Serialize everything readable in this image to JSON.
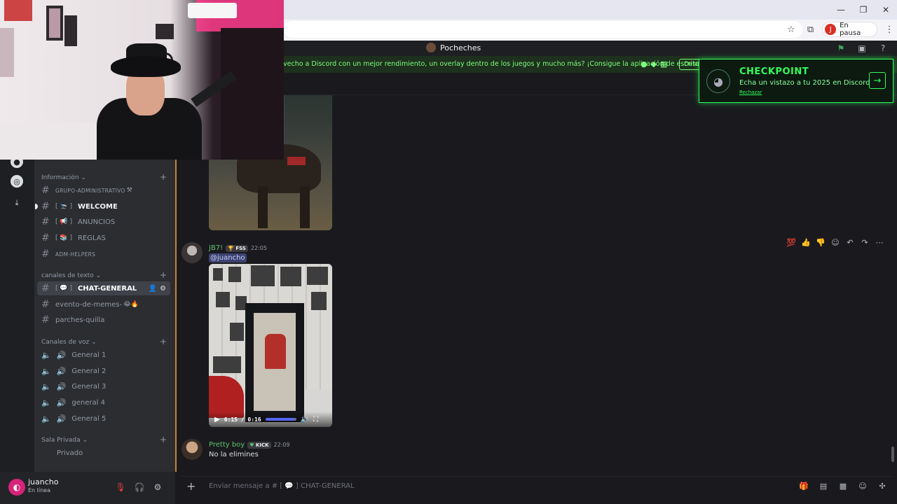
{
  "browser": {
    "profile_initial": "J",
    "profile_status": "En pausa"
  },
  "discord": {
    "server_name": "Pocheches",
    "promo_text": "vecho a Discord con un mejor rendimiento, un overlay dentro de los juegos y mucho más? ¡Consigue la aplicación de escritorio!",
    "promo_button": "Desc"
  },
  "checkpoint": {
    "title": "CHECKPOINT",
    "subtitle": "Echa un vistazo a tu 2025 en Discord",
    "dismiss": "Rechazar"
  },
  "sidebar": {
    "categories": [
      {
        "label": "Información"
      },
      {
        "label": "canales de texto"
      },
      {
        "label": "Canales de voz"
      },
      {
        "label": "Sala Privada"
      }
    ],
    "channels": [
      {
        "label": "GRUPO-ADMINISTRATIVO",
        "emoji": "⚒"
      },
      {
        "label": "WELCOME",
        "prefix": "[ 🛬 ]"
      },
      {
        "label": "ANUNCIOS",
        "prefix": "[ 📢 ]"
      },
      {
        "label": "REGLAS",
        "prefix": "[ 📚 ]"
      },
      {
        "label": "ADM-HELPERS"
      },
      {
        "label": "CHAT-GENERAL",
        "prefix": "[ 💬 ]"
      },
      {
        "label": "evento-de-memes-",
        "emoji": "😂🔥"
      },
      {
        "label": "parches-quilla"
      }
    ],
    "voice": [
      {
        "label": "General 1"
      },
      {
        "label": "General 2"
      },
      {
        "label": "General 3"
      },
      {
        "label": "general 4"
      },
      {
        "label": "General 5"
      }
    ],
    "private": [
      {
        "label": "Privado"
      }
    ]
  },
  "user": {
    "name": "juancho",
    "status": "En línea"
  },
  "messages": [
    {
      "author": "JB7!",
      "badge": "FSS",
      "time": "22:05",
      "mention": "@juancho",
      "video": {
        "current": "0:15",
        "duration": "0:16",
        "progress": 0.94
      },
      "color": "#5ec46b"
    },
    {
      "author": "Pretty boy",
      "badge": "KICK",
      "time": "22:09",
      "text": "No la elimines",
      "color": "#5ec46b"
    }
  ],
  "composer": {
    "placeholder": "Enviar mensaje a #  [ 💬 ]  CHAT-GENERAL"
  },
  "video_time": "0:15 / 0:16",
  "colors": {
    "accent": "#5865f2",
    "checkpoint_green": "#31ff5a",
    "promo_green": "#7dff7d"
  }
}
